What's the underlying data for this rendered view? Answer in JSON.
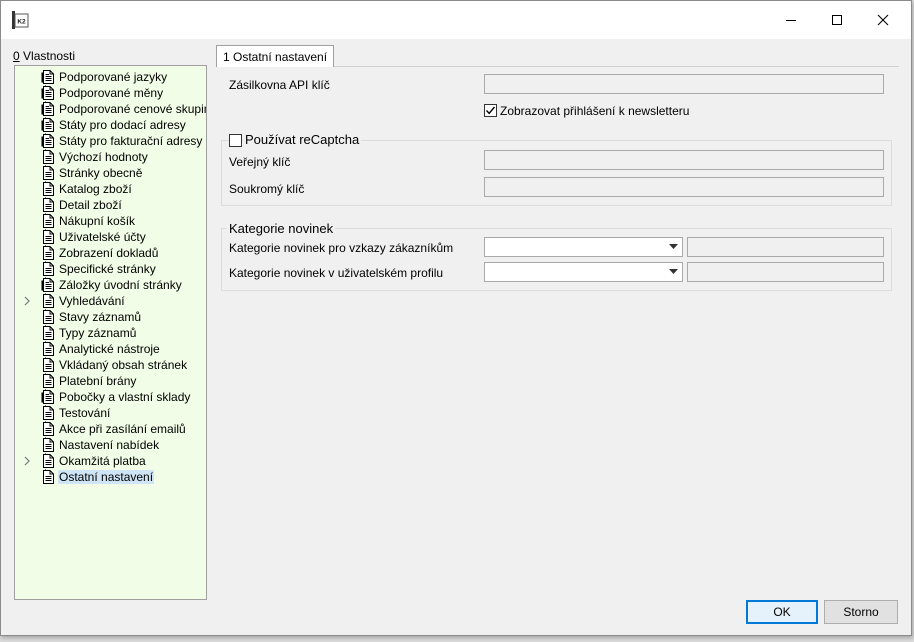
{
  "window": {
    "app_icon_text": "K2",
    "minimize_icon": "minimize-icon",
    "maximize_icon": "maximize-icon",
    "close_icon": "close-icon"
  },
  "sidebar": {
    "title_underlined": "0",
    "title_rest": " Vlastnosti",
    "items": [
      {
        "label": "Podporované jazyky",
        "icon": "document-lines-icon",
        "expandable": false,
        "selected": false
      },
      {
        "label": "Podporované měny",
        "icon": "document-lines-icon",
        "expandable": false,
        "selected": false
      },
      {
        "label": "Podporované cenové skupiny",
        "icon": "document-lines-icon",
        "expandable": false,
        "selected": false
      },
      {
        "label": "Státy pro dodací adresy",
        "icon": "document-lines-icon",
        "expandable": false,
        "selected": false
      },
      {
        "label": "Státy pro fakturační adresy",
        "icon": "document-lines-icon",
        "expandable": false,
        "selected": false
      },
      {
        "label": "Výchozí hodnoty",
        "icon": "document-icon",
        "expandable": false,
        "selected": false
      },
      {
        "label": "Stránky obecně",
        "icon": "document-icon",
        "expandable": false,
        "selected": false
      },
      {
        "label": "Katalog zboží",
        "icon": "document-icon",
        "expandable": false,
        "selected": false
      },
      {
        "label": "Detail zboží",
        "icon": "document-icon",
        "expandable": false,
        "selected": false
      },
      {
        "label": "Nákupní košík",
        "icon": "document-icon",
        "expandable": false,
        "selected": false
      },
      {
        "label": "Uživatelské účty",
        "icon": "document-icon",
        "expandable": false,
        "selected": false
      },
      {
        "label": "Zobrazení dokladů",
        "icon": "document-icon",
        "expandable": false,
        "selected": false
      },
      {
        "label": "Specifické stránky",
        "icon": "document-icon",
        "expandable": false,
        "selected": false
      },
      {
        "label": "Záložky úvodní stránky",
        "icon": "document-lines-icon",
        "expandable": false,
        "selected": false
      },
      {
        "label": "Vyhledávání",
        "icon": "document-icon",
        "expandable": true,
        "selected": false
      },
      {
        "label": "Stavy záznamů",
        "icon": "document-icon",
        "expandable": false,
        "selected": false
      },
      {
        "label": "Typy záznamů",
        "icon": "document-icon",
        "expandable": false,
        "selected": false
      },
      {
        "label": "Analytické nástroje",
        "icon": "document-icon",
        "expandable": false,
        "selected": false
      },
      {
        "label": "Vkládaný obsah stránek",
        "icon": "document-icon",
        "expandable": false,
        "selected": false
      },
      {
        "label": "Platební brány",
        "icon": "document-icon",
        "expandable": false,
        "selected": false
      },
      {
        "label": "Pobočky a vlastní sklady",
        "icon": "document-lines-icon",
        "expandable": false,
        "selected": false
      },
      {
        "label": "Testování",
        "icon": "document-icon",
        "expandable": false,
        "selected": false
      },
      {
        "label": "Akce při zasílání emailů",
        "icon": "document-icon",
        "expandable": false,
        "selected": false
      },
      {
        "label": "Nastavení nabídek",
        "icon": "document-icon",
        "expandable": false,
        "selected": false
      },
      {
        "label": "Okamžitá platba",
        "icon": "document-icon",
        "expandable": true,
        "selected": false
      },
      {
        "label": "Ostatní nastavení",
        "icon": "document-icon",
        "expandable": false,
        "selected": true
      }
    ]
  },
  "tab": {
    "label": "1 Ostatní nastavení"
  },
  "form": {
    "zasilkovna_label": "Zásilkovna API klíč",
    "zasilkovna_value": "",
    "newsletter_label": "Zobrazovat přihlášení k newsletteru",
    "newsletter_checked": true,
    "recaptcha": {
      "title": "Používat reCaptcha",
      "checked": false,
      "public_key_label": "Veřejný klíč",
      "public_key_value": "",
      "private_key_label": "Soukromý klíč",
      "private_key_value": ""
    },
    "news": {
      "title": "Kategorie novinek",
      "customer_messages_label": "Kategorie novinek pro vzkazy zákazníkům",
      "customer_messages_value": "",
      "user_profile_label": "Kategorie novinek v uživatelském profilu",
      "user_profile_value": ""
    }
  },
  "buttons": {
    "ok": "OK",
    "cancel": "Storno"
  }
}
